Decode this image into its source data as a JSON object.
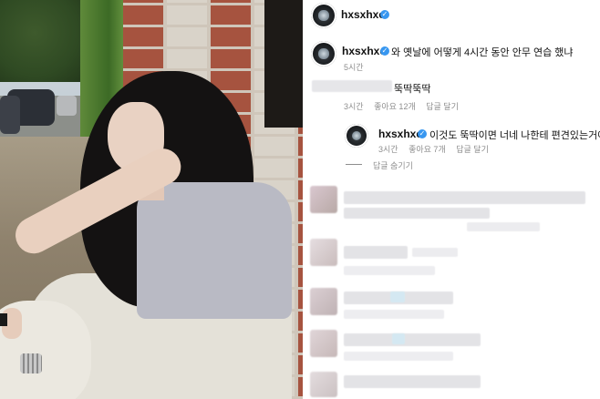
{
  "post": {
    "author": "hxsxhxe"
  },
  "comments": [
    {
      "author": "hxsxhxe",
      "text": "와 옛날에 어떻게 4시간 동안 안무 연습 했냐",
      "time": "5시간"
    },
    {
      "text": "뚝딱뚝딱",
      "time": "3시간",
      "likes": "좋아요 12개",
      "reply_label": "답글 달기"
    },
    {
      "author": "hxsxhxe",
      "text": "이것도 뚝딱이면 너네 나한테 편견있는거야.",
      "time": "3시간",
      "likes": "좋아요 7개",
      "reply_label": "답글 달기"
    }
  ],
  "hide_replies_label": "답글 숨기기",
  "colors": {
    "verified": "#3897f0",
    "meta_text": "#8e8e8e"
  }
}
